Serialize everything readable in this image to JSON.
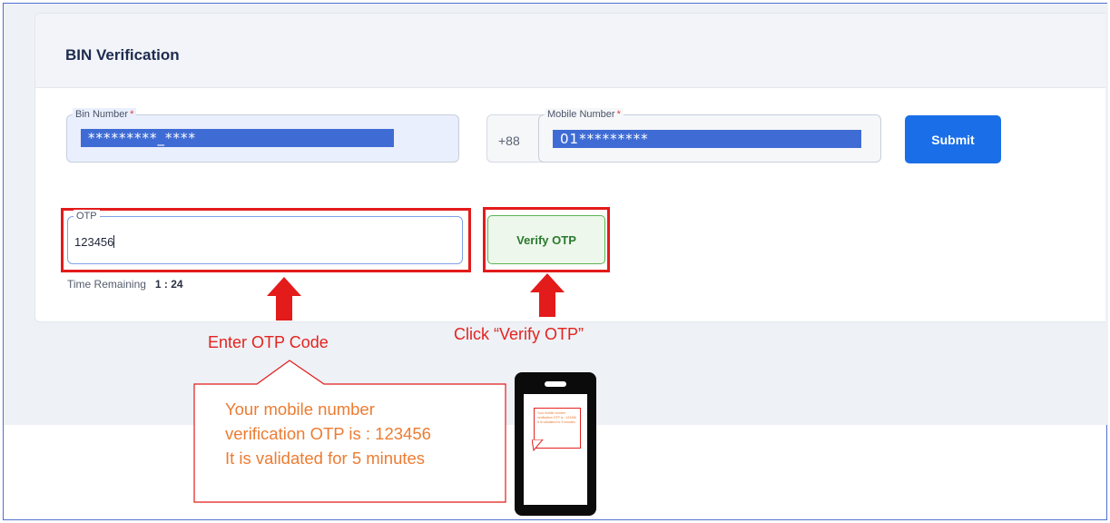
{
  "card": {
    "title": "BIN Verification"
  },
  "bin": {
    "label": "Bin Number",
    "required_mark": "*",
    "value": "*********_****"
  },
  "mobile": {
    "country_code": "+88",
    "label": "Mobile Number",
    "required_mark": "*",
    "value": "01*********"
  },
  "submit": {
    "label": "Submit"
  },
  "otp": {
    "label": "OTP",
    "value": "123456"
  },
  "verify": {
    "label": "Verify OTP"
  },
  "timer": {
    "label": "Time Remaining",
    "value": "1 : 24"
  },
  "annotations": {
    "enter_otp": "Enter OTP Code",
    "click_verify": "Click “Verify OTP”",
    "sms_lines": [
      "Your mobile number",
      "verification OTP is : 123456",
      "It is validated for 5 minutes"
    ],
    "arrow_color": "#e31b1b",
    "box_color": "#e31b1b",
    "sms_text_color": "#ec7c32"
  },
  "colors": {
    "primary": "#1a6fe8",
    "masked_fill": "#3f6cd4",
    "verify_border": "#5ab553",
    "required": "#e0443e"
  }
}
